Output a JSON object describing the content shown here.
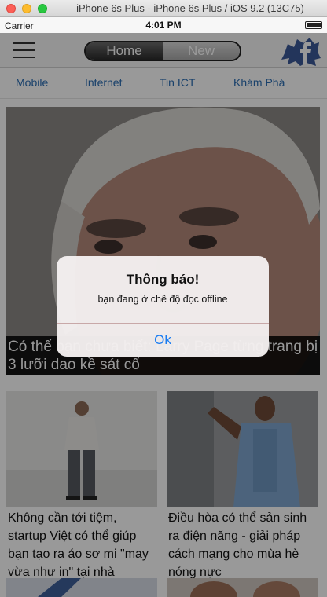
{
  "window": {
    "title": "iPhone 6s Plus - iPhone 6s Plus / iOS 9.2 (13C75)"
  },
  "statusbar": {
    "carrier": "Carrier",
    "time": "4:01 PM"
  },
  "navbar": {
    "tabs": [
      "Home",
      "New"
    ],
    "active_tab": "Home",
    "menu_icon": "hamburger-menu-icon",
    "logo_icon": "facebook-logo-icon"
  },
  "categories": [
    "Mobile",
    "Internet",
    "Tin ICT",
    "Khám Phá"
  ],
  "hero": {
    "caption": "Có thể bạn chưa biết: Larry Page từng trang bị 3 lưỡi dao kề sát cổ"
  },
  "cards": [
    {
      "caption": "Không cần tới tiệm, startup Việt có thể giúp bạn tạo ra áo sơ mi \"may vừa như in\" tại nhà"
    },
    {
      "caption": "Điều hòa có thể sản sinh ra điện năng - giải pháp cách mạng cho mùa hè nóng nực"
    }
  ],
  "alert": {
    "title": "Thông báo!",
    "message": "bạn đang ở chế độ đọc offline",
    "button": "Ok"
  },
  "colors": {
    "category_text": "#2a6db3",
    "alert_button": "#1a7cf2",
    "facebook_blue": "#3b5998"
  }
}
